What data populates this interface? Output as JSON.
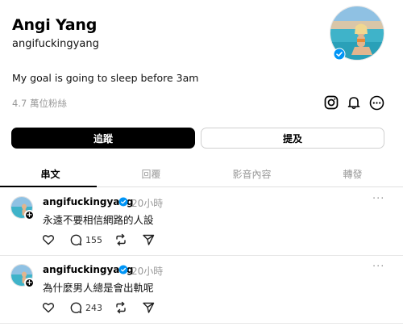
{
  "profile": {
    "name": "Angi Yang",
    "handle": "angifuckingyang",
    "bio": "My goal is going to sleep before 3am",
    "followers": "4.7 萬位粉絲"
  },
  "buttons": {
    "follow": "追蹤",
    "mention": "提及"
  },
  "tabs": [
    {
      "label": "串文",
      "active": true
    },
    {
      "label": "回覆",
      "active": false
    },
    {
      "label": "影音內容",
      "active": false
    },
    {
      "label": "轉發",
      "active": false
    }
  ],
  "posts": [
    {
      "author": "angifuckingyang",
      "time": "20小時",
      "text": "永遠不要相信網路的人設",
      "comments": "155",
      "more": "···"
    },
    {
      "author": "angifuckingyang",
      "time": "20小時",
      "text": "為什麼男人總是會出軌呢",
      "comments": "243",
      "more": "···"
    }
  ],
  "icons": {
    "header_actions": [
      "instagram-icon",
      "bell-icon",
      "more-circle-icon"
    ],
    "post_actions": [
      "heart-icon",
      "comment-icon",
      "repost-icon",
      "share-icon"
    ]
  },
  "colors": {
    "accent": "#000000",
    "verified": "#0095f6",
    "muted": "#999999"
  }
}
